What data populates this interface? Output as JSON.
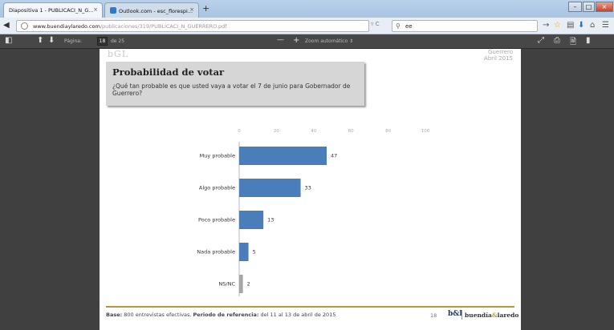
{
  "browser": {
    "tabs": [
      {
        "label": "Diapositiva 1 - PUBLICACI_N_G..."
      },
      {
        "label": "Outlook.com - esc_florespi..."
      }
    ],
    "url_host": "www.buendiaylaredo.com",
    "url_path": "/publicaciones/319/PUBLICACI_N_GUERRERO.pdf",
    "search_value": "ee"
  },
  "pdf_toolbar": {
    "page_label": "Página:",
    "page_value": "18",
    "page_total": "de 25",
    "zoom_label": "Zoom automático"
  },
  "slide": {
    "logo_text": "bGL",
    "state_line1": "Guerrero",
    "state_line2": "Abril 2015",
    "title": "Probabilidad de votar",
    "question": "¿Qué tan probable es que usted vaya a votar el 7 de junio para Gobernador de Guerrero?",
    "footer_base_label": "Base:",
    "footer_base_text": " 800 entrevistas efectivas. ",
    "footer_period_label": "Periodo de referencia:",
    "footer_period_text": " del 11 al 13 de abril de 2015",
    "page_number": "18",
    "brand_logo": "b&l",
    "brand_part1": "buendía",
    "brand_amp": "&",
    "brand_part2": "laredo"
  },
  "colors": {
    "bar_primary": "#4a7ebb",
    "bar_secondary": "#a6a6a6",
    "accent_gold": "#b49a3a"
  },
  "chart_data": {
    "type": "bar",
    "orientation": "horizontal",
    "categories": [
      "Muy probable",
      "Algo probable",
      "Poco probable",
      "Nada probable",
      "NS/NC"
    ],
    "values": [
      47,
      33,
      13,
      5,
      2
    ],
    "xlim": [
      0,
      100
    ],
    "xticks": [
      0,
      20,
      40,
      60,
      80,
      100
    ],
    "grid": false
  }
}
